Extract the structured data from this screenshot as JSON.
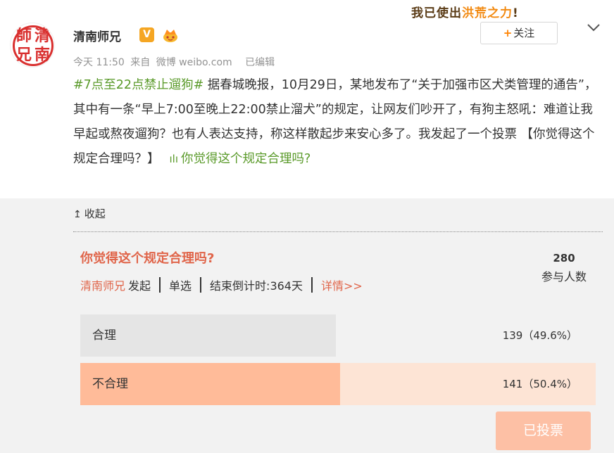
{
  "header": {
    "avatar_chars": [
      "師",
      "清",
      "兄",
      "南"
    ],
    "username": "清南师兄",
    "vip_badge": "V",
    "meta": {
      "time": "今天 11:50",
      "source_prefix": "来自",
      "source": "微博 weibo.com",
      "edited": "已编辑"
    }
  },
  "top_right": {
    "slogan_part1": "我已使出",
    "slogan_part2": "洪荒之力",
    "slogan_part3": "!",
    "follow_plus": "+",
    "follow_label": "关注",
    "menu_icon": "chevron-down-icon"
  },
  "post": {
    "hashtag": "#7点至22点禁止遛狗#",
    "text": " 据春城晚报，10月29日，某地发布了“关于加强市区犬类管理的通告”，其中有一条“早上7:00至晚上22:00禁止溜犬”的规定，让网友们吵开了，有狗主怒吼：难道让我早起或熬夜遛狗？也有人表达支持，称这样散起步来安心多了。我发起了一个投票 【你觉得这个规定合理吗？】",
    "poll_link_icon": "poll-icon",
    "poll_link": "你觉得这个规定合理吗?"
  },
  "collapse": {
    "arrow": "↥",
    "label": "收起"
  },
  "poll": {
    "title": "你觉得这个规定合理吗?",
    "participant_count": "280",
    "participant_label": "参与人数",
    "author": "清南师兄",
    "author_suffix": "发起",
    "type": "单选",
    "countdown": "结束倒计时:364天",
    "details": "详情>>",
    "options": [
      {
        "label": "合理",
        "result": "139（49.6%）",
        "fraction": 0.496
      },
      {
        "label": "不合理",
        "result": "141（50.4%）",
        "fraction": 0.504
      }
    ],
    "voted_button": "已投票"
  },
  "colors": {
    "accent": "#e0654a",
    "link_green": "#5a9a2a",
    "follow_orange": "#ff8200",
    "option_selected_fill": "#ffbb99",
    "option_selected_bg": "#fde4d5",
    "option_fill": "#e5e5e5",
    "voted_button": "#fdc0a5"
  }
}
